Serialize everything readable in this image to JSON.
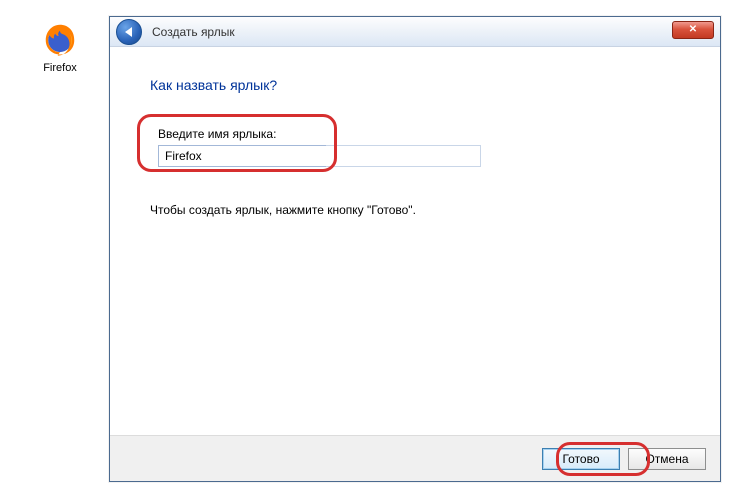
{
  "desktop": {
    "icon_label": "Firefox"
  },
  "window": {
    "title": "Создать ярлык",
    "heading": "Как назвать ярлык?",
    "field_label": "Введите имя ярлыка:",
    "field_value": "Firefox",
    "hint": "Чтобы создать ярлык, нажмите кнопку \"Готово\".",
    "buttons": {
      "done": "Готово",
      "cancel": "Отмена"
    }
  },
  "icons": {
    "close": "✕"
  }
}
